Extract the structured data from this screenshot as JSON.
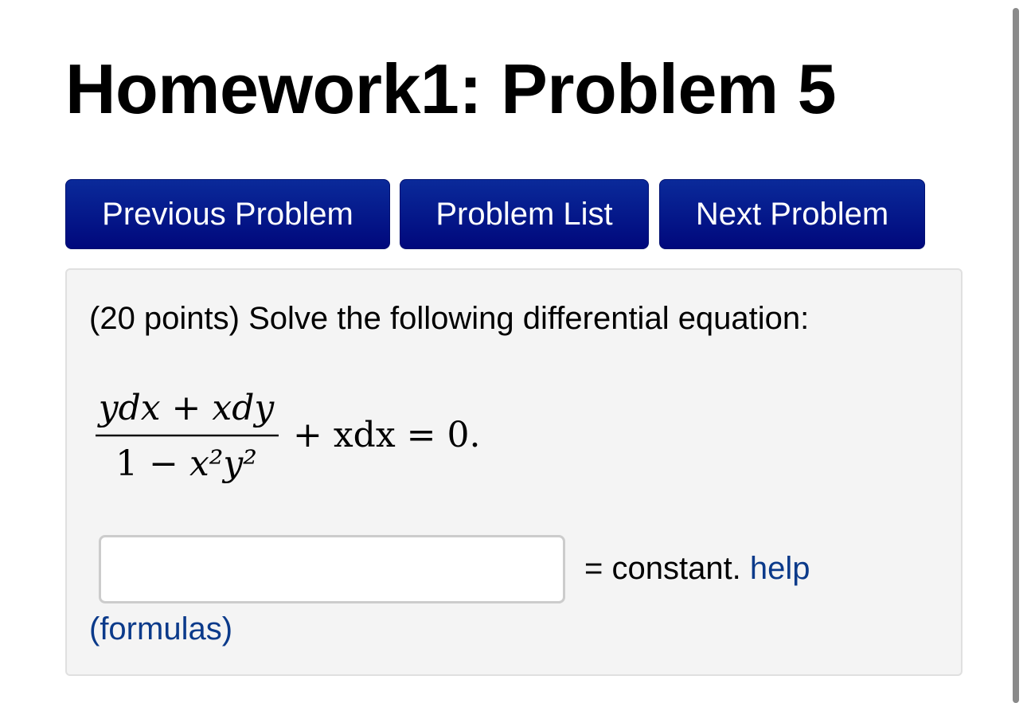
{
  "header": {
    "title": "Homework1: Problem 5"
  },
  "nav": {
    "previous_label": "Previous Problem",
    "list_label": "Problem List",
    "next_label": "Next Problem"
  },
  "problem": {
    "prompt": "(20 points) Solve the following differential equation:",
    "equation": {
      "numerator": "ydx + xdy",
      "denominator_lead": "1 − ",
      "denominator_tail": "x²y²",
      "rest": "+ xdx = 0."
    },
    "answer": {
      "value": "",
      "placeholder": ""
    },
    "equals_text": "= constant.",
    "help_link": "help",
    "formulas_link": "(formulas)"
  },
  "colors": {
    "button_bg": "#00087c",
    "link": "#0b3a8a",
    "panel_bg": "#f4f4f4"
  }
}
